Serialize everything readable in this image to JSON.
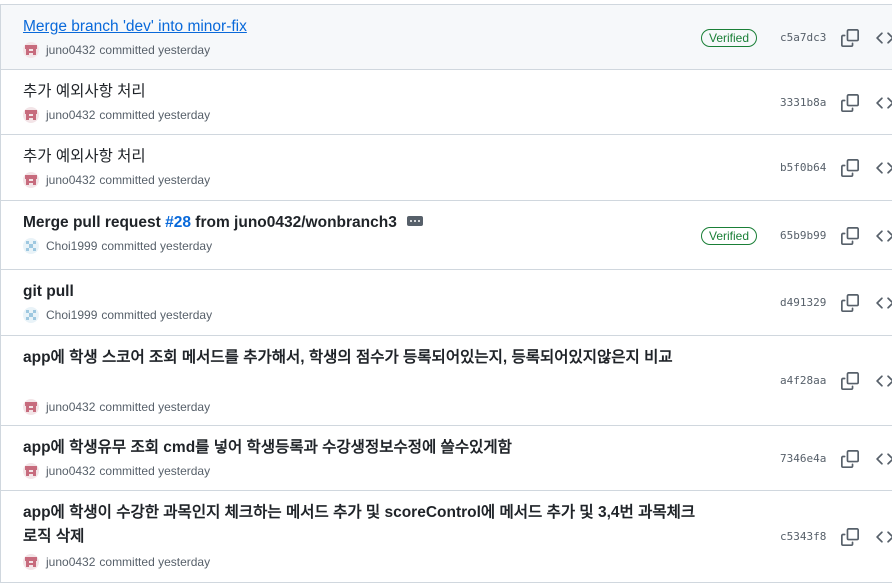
{
  "commits": [
    {
      "title_parts": [
        {
          "text": "Merge branch 'dev' into minor-fix",
          "style": "link"
        }
      ],
      "author": "juno0432",
      "meta": "committed yesterday",
      "avatar": "juno",
      "verified": "Verified",
      "sha": "c5a7dc3",
      "highlight": true,
      "bold": false,
      "ellipsis": false,
      "lines": 1
    },
    {
      "title_parts": [
        {
          "text": "추가 예외사항 처리",
          "style": "plain"
        }
      ],
      "author": "juno0432",
      "meta": "committed yesterday",
      "avatar": "juno",
      "verified": "",
      "sha": "3331b8a",
      "highlight": false,
      "bold": false,
      "ellipsis": false,
      "lines": 1
    },
    {
      "title_parts": [
        {
          "text": "추가 예외사항 처리",
          "style": "plain"
        }
      ],
      "author": "juno0432",
      "meta": "committed yesterday",
      "avatar": "juno",
      "verified": "",
      "sha": "b5f0b64",
      "highlight": false,
      "bold": false,
      "ellipsis": false,
      "lines": 1
    },
    {
      "title_parts": [
        {
          "text": "Merge pull request ",
          "style": "plain"
        },
        {
          "text": "#28",
          "style": "pr"
        },
        {
          "text": " from juno0432/wonbranch3",
          "style": "plain"
        }
      ],
      "author": "Choi1999",
      "meta": "committed yesterday",
      "avatar": "choi",
      "verified": "Verified",
      "sha": "65b9b99",
      "highlight": false,
      "bold": true,
      "ellipsis": true,
      "lines": 1
    },
    {
      "title_parts": [
        {
          "text": "git pull",
          "style": "plain"
        }
      ],
      "author": "Choi1999",
      "meta": "committed yesterday",
      "avatar": "choi",
      "verified": "",
      "sha": "d491329",
      "highlight": false,
      "bold": true,
      "ellipsis": false,
      "lines": 1
    },
    {
      "title_parts": [
        {
          "text": "app에 학생 스코어 조회 메서드를 추가해서, 학생의 점수가 등록되어있는지, 등록되어있지않은지 비교",
          "style": "plain"
        }
      ],
      "author": "juno0432",
      "meta": "committed yesterday",
      "avatar": "juno",
      "verified": "",
      "sha": "a4f28aa",
      "highlight": false,
      "bold": true,
      "ellipsis": false,
      "lines": 2
    },
    {
      "title_parts": [
        {
          "text": "app에 학생유무 조회 cmd를 넣어 학생등록과 수강생정보수정에 쓸수있게함",
          "style": "plain"
        }
      ],
      "author": "juno0432",
      "meta": "committed yesterday",
      "avatar": "juno",
      "verified": "",
      "sha": "7346e4a",
      "highlight": false,
      "bold": true,
      "ellipsis": false,
      "lines": 1
    },
    {
      "title_parts": [
        {
          "text": "app에 학생이 수강한 과목인지 체크하는 메서드 추가 및 scoreControl에 메서드 추가 및 3,4번 과목체크로직 삭제",
          "style": "plain"
        }
      ],
      "author": "juno0432",
      "meta": "committed yesterday",
      "avatar": "juno",
      "verified": "",
      "sha": "c5343f8",
      "highlight": false,
      "bold": true,
      "ellipsis": false,
      "lines": 2
    }
  ],
  "colors": {
    "link": "#0969da",
    "verified": "#1a7f37",
    "muted": "#57606a",
    "juno_avatar": "#c76b7d",
    "choi_avatar": "#9ec8e0"
  },
  "icons": {
    "copy": "copy-icon",
    "browse": "code-icon",
    "hidden_text": "ellipsis-icon"
  }
}
